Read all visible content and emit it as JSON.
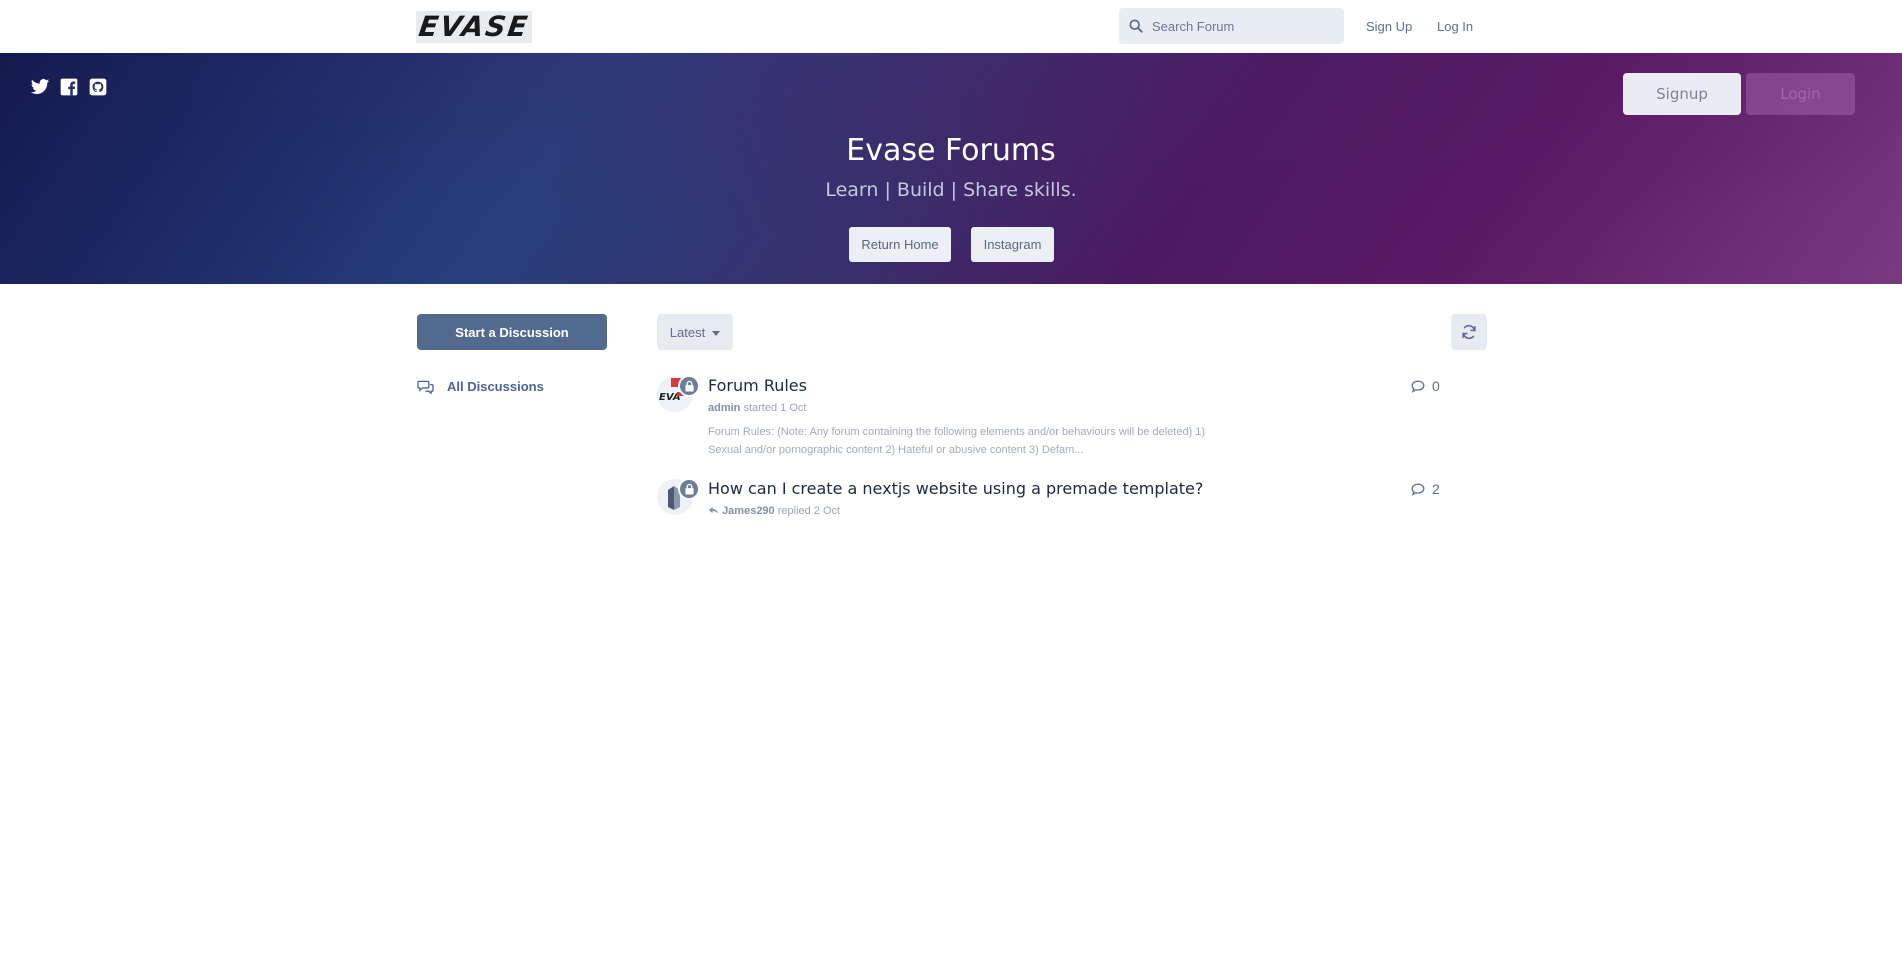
{
  "header": {
    "logo_text": "EVASE",
    "search_placeholder": "Search Forum",
    "signup_label": "Sign Up",
    "login_label": "Log In"
  },
  "hero": {
    "social_icons": [
      "twitter-icon",
      "facebook-icon",
      "github-icon"
    ],
    "signup_label": "Signup",
    "login_label": "Login",
    "title": "Evase Forums",
    "subtitle": "Learn | Build | Share skills.",
    "return_home_label": "Return Home",
    "instagram_label": "Instagram"
  },
  "sidebar": {
    "start_discussion_label": "Start a Discussion",
    "nav_all_label": "All Discussions"
  },
  "toolbar": {
    "sort_label": "Latest"
  },
  "discussions": [
    {
      "title": "Forum Rules",
      "author": "admin",
      "action": "started 1 Oct",
      "excerpt": "Forum Rules: (Note: Any forum containing the following elements and/or behaviours will be deleted) 1) Sexual and/or pornographic content 2) Hateful or abusive content 3) Defam...",
      "reply_count": "0"
    },
    {
      "title": "How can I create a nextjs website using a premade template?",
      "author": "James290",
      "action": "replied 2 Oct",
      "reply_count": "2"
    }
  ],
  "colors": {
    "primary": "#536a8f",
    "link": "#4a6491",
    "hero_start": "#151a4e",
    "hero_end": "#7a3a82"
  }
}
